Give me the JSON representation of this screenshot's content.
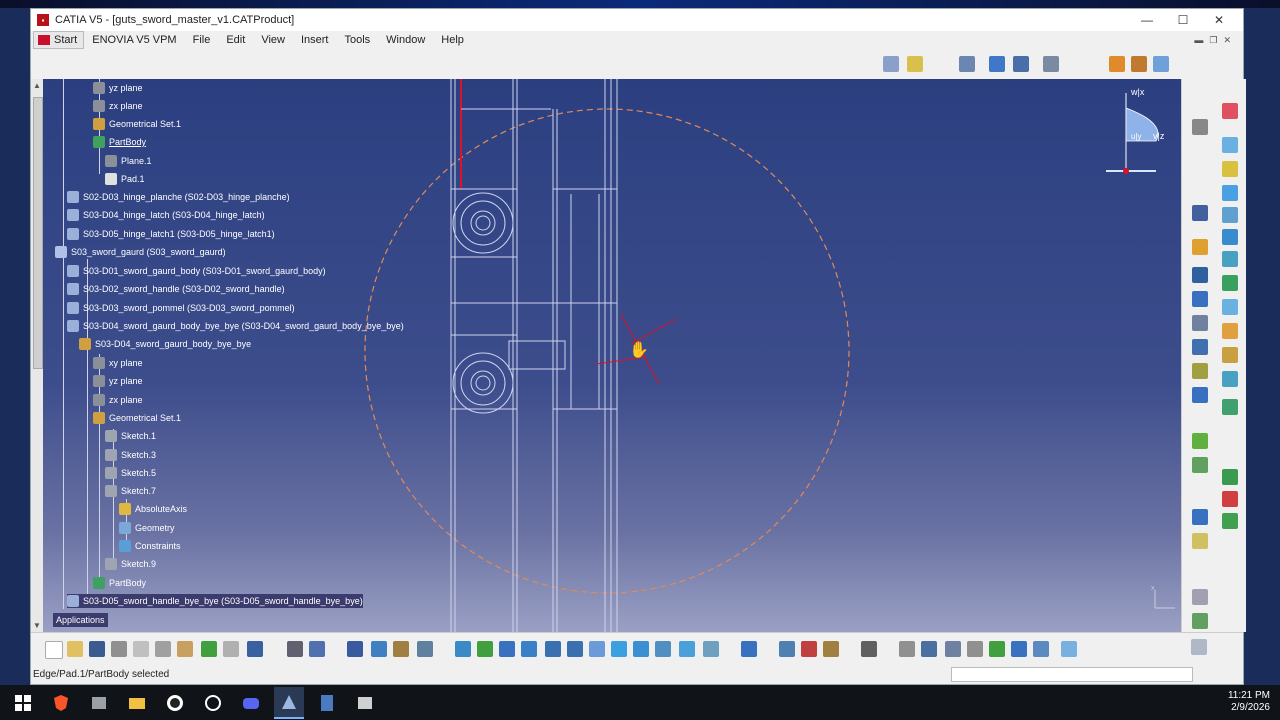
{
  "window": {
    "title": "CATIA V5 - [guts_sword_master_v1.CATProduct]",
    "controls": [
      "—",
      "☐",
      "✕"
    ]
  },
  "menu": {
    "start": "Start",
    "items": [
      "ENOVIA V5 VPM",
      "File",
      "Edit",
      "View",
      "Insert",
      "Tools",
      "Window",
      "Help"
    ]
  },
  "tree": {
    "items": [
      "yz plane",
      "zx plane",
      "Geometrical Set.1",
      "PartBody",
      "Plane.1",
      "Pad.1",
      "S02-D03_hinge_planche (S02-D03_hinge_planche)",
      "S03-D04_hinge_latch (S03-D04_hinge_latch)",
      "S03-D05_hinge_latch1 (S03-D05_hinge_latch1)",
      "S03_sword_gaurd (S03_sword_gaurd)",
      "S03-D01_sword_gaurd_body (S03-D01_sword_gaurd_body)",
      "S03-D02_sword_handle (S03-D02_sword_handle)",
      "S03-D03_sword_pommel (S03-D03_sword_pommel)",
      "S03-D04_sword_gaurd_body_bye_bye (S03-D04_sword_gaurd_body_bye_bye)",
      "S03-D04_sword_gaurd_body_bye_bye",
      "xy plane",
      "yz plane",
      "zx plane",
      "Geometrical Set.1",
      "Sketch.1",
      "Sketch.3",
      "Sketch.5",
      "Sketch.7",
      "AbsoluteAxis",
      "Geometry",
      "Constraints",
      "Sketch.9",
      "PartBody",
      "S03-D05_sword_handle_bye_bye (S03-D05_sword_handle_bye_bye)",
      "Applications"
    ]
  },
  "compass": {
    "w_label": "w|x",
    "v_label": "v|z",
    "u_label": "u|y"
  },
  "status": {
    "message": "Edge/Pad.1/PartBody selected"
  },
  "clock": {
    "time": "11:21 PM",
    "date": "2/9/2026"
  },
  "colors": {
    "viewport_top": "#2b3f80",
    "viewport_bottom": "#9aa0c4",
    "geometry_line": "#cfd3ee",
    "construction_circle": "#e08a5a",
    "highlight_edge": "#e0102a"
  }
}
